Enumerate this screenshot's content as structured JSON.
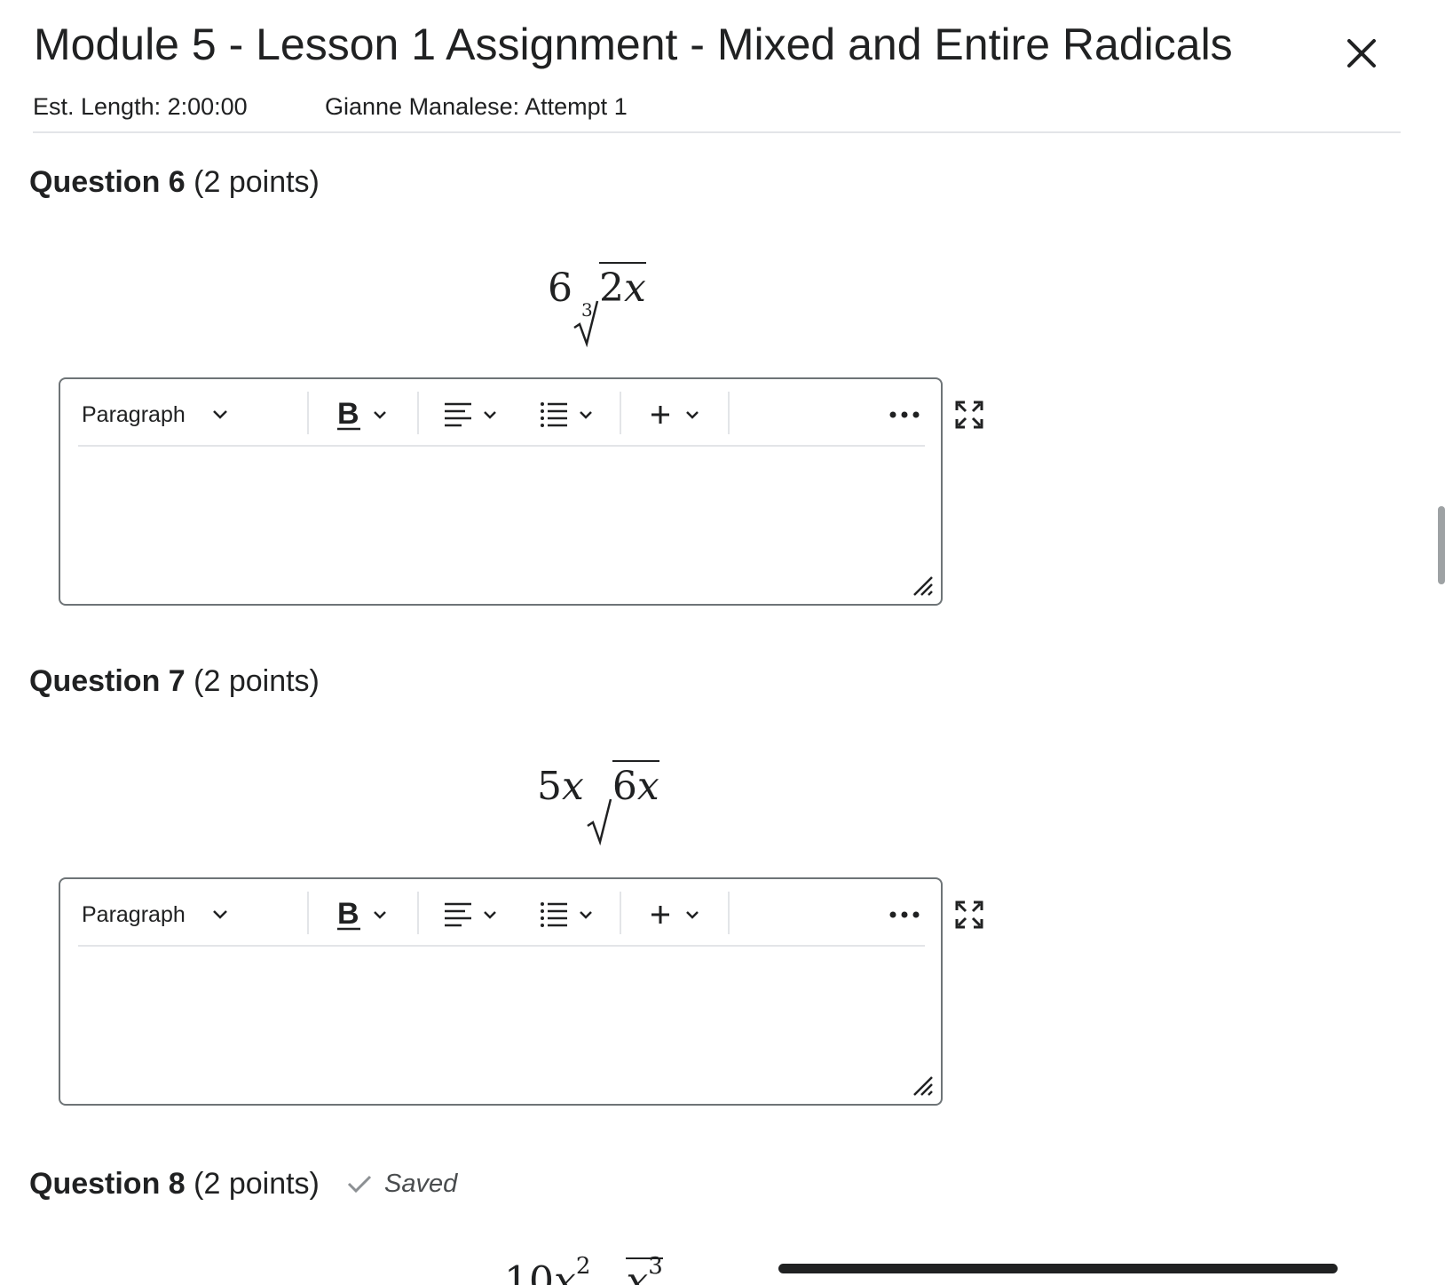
{
  "header": {
    "title": "Module 5 - Lesson 1 Assignment - Mixed and Entire Radicals",
    "est_length": "Est. Length: 2:00:00",
    "attempt": "Gianne Manalese: Attempt 1"
  },
  "questions": [
    {
      "label": "Question 6",
      "points": "(2 points)",
      "expression": {
        "coefficient": "6",
        "index": "3",
        "radicand_num": "2",
        "radicand_var": "x"
      }
    },
    {
      "label": "Question 7",
      "points": "(2 points)",
      "expression": {
        "coefficient": "5",
        "coefficient_var": "x",
        "radicand_num": "6",
        "radicand_var": "x"
      }
    },
    {
      "label": "Question 8",
      "points": "(2 points)",
      "status": "Saved",
      "expression_partial": {
        "coefficient": "10",
        "exponent": "2",
        "radicand_exponent": "3"
      }
    }
  ],
  "editor": {
    "block_format": "Paragraph",
    "tools": [
      "block-format",
      "bold",
      "align",
      "list",
      "insert",
      "more",
      "fullscreen"
    ],
    "content": ""
  },
  "icons": {
    "close": "close-icon",
    "bold": "bold-icon",
    "align": "align-left-icon",
    "list": "bulleted-list-icon",
    "insert": "plus-icon",
    "more": "more-horizontal-icon",
    "fullscreen": "fullscreen-icon",
    "resize": "resize-grip-icon",
    "saved": "checkmark-icon"
  },
  "colors": {
    "text": "#202122",
    "border": "#6e7477",
    "divider": "#e3e5e8",
    "saved_check": "#8c9093"
  }
}
